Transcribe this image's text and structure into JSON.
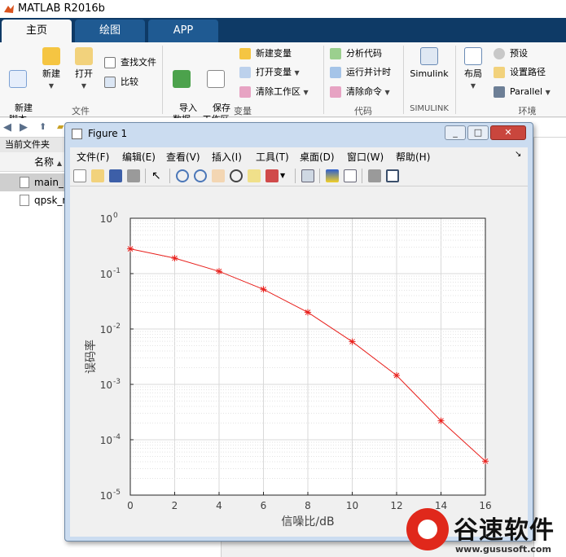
{
  "app": {
    "title": "MATLAB R2016b"
  },
  "tabs": [
    {
      "label": "主页",
      "active": true
    },
    {
      "label": "绘图",
      "active": false
    },
    {
      "label": "APP",
      "active": false
    }
  ],
  "ribbon": {
    "file_group": {
      "label": "文件",
      "new_script": "新建\n脚本",
      "new": "新建",
      "open": "打开",
      "find_files": "查找文件",
      "compare": "比较"
    },
    "variable_group": {
      "label": "变量",
      "import_data": "导入\n数据",
      "save_workspace": "保存\n工作区",
      "new_variable": "新建变量",
      "open_variable": "打开变量",
      "clear_workspace": "清除工作区"
    },
    "code_group": {
      "label": "代码",
      "analyze_code": "分析代码",
      "run_and_time": "运行并计时",
      "clear_commands": "清除命令"
    },
    "simulink_group": {
      "label": "SIMULINK",
      "simulink": "Simulink"
    },
    "env_group": {
      "label": "环境",
      "layout": "布局",
      "preferences": "预设",
      "set_path": "设置路径",
      "parallel": "Parallel"
    }
  },
  "file_panel": {
    "header": "当前文件夹",
    "column": "名称",
    "files": [
      {
        "name": "main_r",
        "selected": true
      },
      {
        "name": "qpsk_r",
        "selected": false
      }
    ]
  },
  "figure": {
    "title": "Figure 1",
    "menu": [
      "文件(F)",
      "编辑(E)",
      "查看(V)",
      "插入(I)",
      "工具(T)",
      "桌面(D)",
      "窗口(W)",
      "帮助(H)"
    ]
  },
  "chart_data": {
    "type": "line",
    "x": [
      0,
      2,
      4,
      6,
      8,
      10,
      12,
      14,
      16
    ],
    "series": [
      {
        "values": [
          0.28,
          0.19,
          0.11,
          0.052,
          0.02,
          0.0059,
          0.00145,
          0.00022,
          4.1e-05
        ],
        "color": "#e8201c",
        "marker": "*"
      }
    ],
    "xlabel": "信噪比/dB",
    "ylabel": "误码率",
    "xlim": [
      0,
      16
    ],
    "ylim": [
      1e-05,
      1
    ],
    "yscale": "log",
    "xticks": [
      "0",
      "2",
      "4",
      "6",
      "8",
      "10",
      "12",
      "14",
      "16"
    ],
    "yticks": [
      {
        "base": "10",
        "exp": "0"
      },
      {
        "base": "10",
        "exp": "-1"
      },
      {
        "base": "10",
        "exp": "-2"
      },
      {
        "base": "10",
        "exp": "-3"
      },
      {
        "base": "10",
        "exp": "-4"
      },
      {
        "base": "10",
        "exp": "-5"
      }
    ],
    "grid": true,
    "minor_grid": true
  },
  "watermark": {
    "text": "谷速软件",
    "url": "www.gususoft.com"
  }
}
